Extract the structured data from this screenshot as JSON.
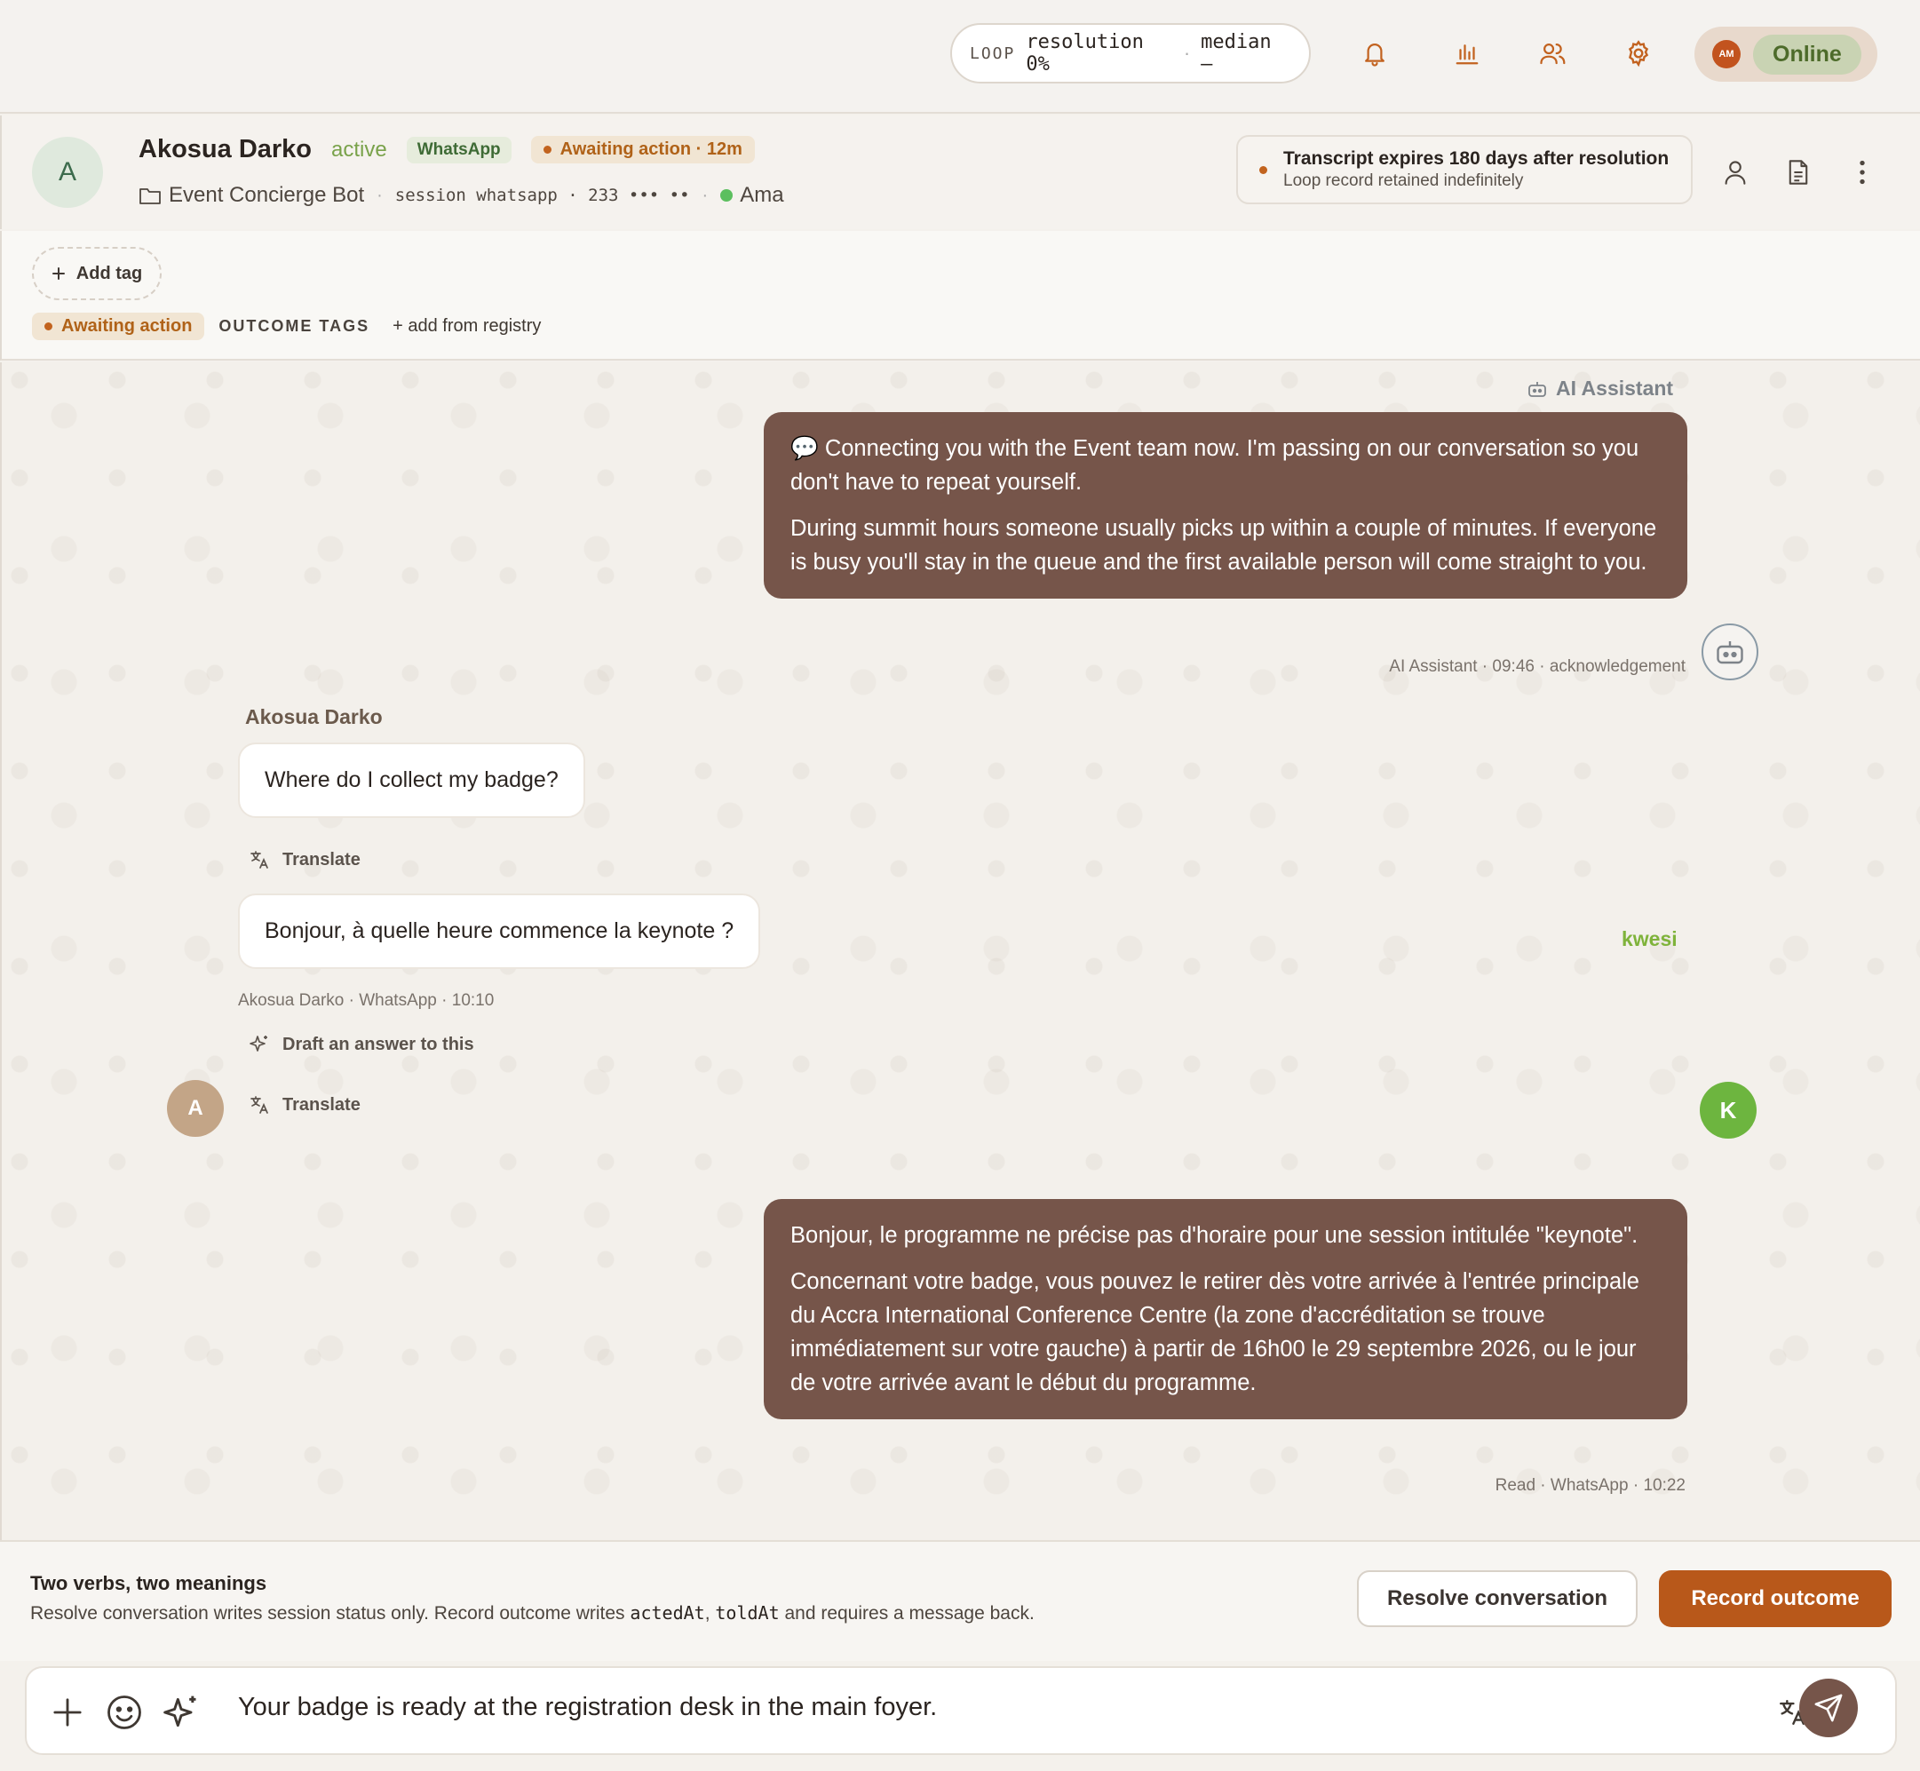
{
  "topbar": {
    "loop_tag": "LOOP",
    "loop_resolution": "resolution 0%",
    "loop_separator": "·",
    "loop_median": "median —",
    "presence_initials": "AM",
    "presence_status": "Online"
  },
  "header": {
    "avatar_letter": "A",
    "contact_name": "Akosua Darko",
    "contact_state": "active",
    "channel_badge": "WhatsApp",
    "awaiting_badge": "Awaiting action · 12m",
    "bot_name": "Event Concierge Bot",
    "separator": "·",
    "session_text": "session whatsapp · 233 ••• ••",
    "agent_name": "Ama",
    "expiry_title": "Transcript expires 180 days after resolution",
    "expiry_subtitle": "Loop record retained indefinitely"
  },
  "tags": {
    "add_tag_label": "Add tag",
    "awaiting_tag": "Awaiting action",
    "outcome_tags_label": "OUTCOME TAGS",
    "add_from_registry": "+ add from registry"
  },
  "messages": {
    "ai_sender_label": "AI Assistant",
    "ai_message_p1": "💬 Connecting you with the Event team now. I'm passing on our conversation so you don't have to repeat yourself.",
    "ai_message_p2": "During summit hours someone usually picks up within a couple of minutes. If everyone is busy you'll stay in the queue and the first available person will come straight to you.",
    "ai_meta": "AI Assistant · 09:46 · acknowledgement",
    "customer_name": "Akosua Darko",
    "customer_msg_1": "Where do I collect my badge?",
    "translate_label": "Translate",
    "customer_msg_2": "Bonjour, à quelle heure commence la keynote ?",
    "customer_meta": "Akosua Darko · WhatsApp · 10:10",
    "draft_label": "Draft an answer to this",
    "customer_avatar_letter": "A",
    "agent_sender": "kwesi",
    "agent_message_p1": "Bonjour, le programme ne précise pas d'horaire pour une session intitulée \"keynote\".",
    "agent_message_p2": "Concernant votre badge, vous pouvez le retirer dès votre arrivée à l'entrée principale du Accra International Conference Centre (la zone d'accréditation se trouve immédiatement sur votre gauche) à partir de 16h00 le 29 septembre 2026, ou le jour de votre arrivée avant le début du programme.",
    "agent_meta": "Read · WhatsApp · 10:22",
    "agent_avatar_letter": "K"
  },
  "actionbar": {
    "title": "Two verbs, two meanings",
    "desc_prefix": "Resolve conversation writes session status only. Record outcome writes ",
    "code_1": "actedAt",
    "desc_comma": ", ",
    "code_2": "toldAt",
    "desc_suffix": " and requires a message back.",
    "resolve_button": "Resolve conversation",
    "record_button": "Record outcome"
  },
  "composer": {
    "input_value": "Your badge is ready at the registration desk in the main foyer."
  },
  "colors": {
    "brand_brown": "#76554a",
    "accent_orange": "#b8581a",
    "online_green": "#6db53f"
  },
  "icons": [
    "bell-icon",
    "bar-chart-icon",
    "users-icon",
    "gear-icon",
    "user-icon",
    "document-icon",
    "more-vertical-icon",
    "folder-icon",
    "robot-icon",
    "translate-icon",
    "sparkle-icon",
    "plus-icon",
    "emoji-icon",
    "send-icon"
  ]
}
